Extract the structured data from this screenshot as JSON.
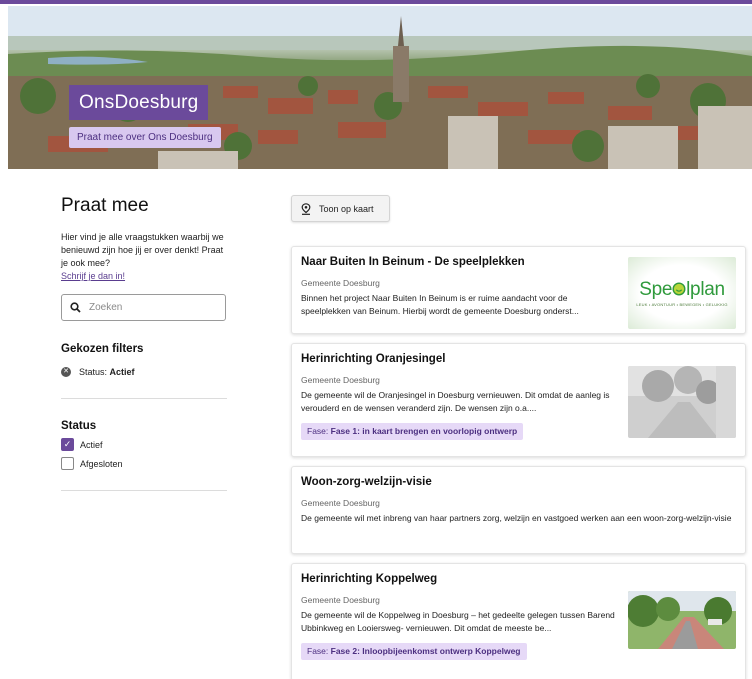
{
  "hero": {
    "brand": "OnsDoesburg",
    "tagline": "Praat mee over Ons Doesburg"
  },
  "sidebar": {
    "title": "Praat mee",
    "intro": "Hier vind je alle vraagstukken waarbij we benieuwd zijn hoe jij er over denkt! Praat je ook mee?",
    "signup_link": "Schrijf je dan in!",
    "search_placeholder": "Zoeken",
    "chosen_filters_title": "Gekozen filters",
    "chosen_filter_label": "Status:",
    "chosen_filter_value": "Actief",
    "status_title": "Status",
    "status_options": [
      {
        "label": "Actief",
        "checked": true
      },
      {
        "label": "Afgesloten",
        "checked": false
      }
    ]
  },
  "map_button": "Toon op kaart",
  "cards": [
    {
      "title": "Naar Buiten In Beinum - De speelplekken",
      "org": "Gemeente Doesburg",
      "description": "Binnen het project Naar Buiten In Beinum is er ruime aandacht voor de speelplekken van Beinum. Hierbij wordt de gemeente Doesburg onderst...",
      "logo_text": "Spe lplan",
      "logo_sub": "LEUK • AVONTUUR • BEWEGEN • GELUKKIG"
    },
    {
      "title": "Herinrichting Oranjesingel",
      "org": "Gemeente Doesburg",
      "description": "De gemeente wil de Oranjesingel in Doesburg vernieuwen. Dit omdat de aanleg is verouderd en de wensen veranderd zijn. De wensen zijn o.a....",
      "phase_label": "Fase:",
      "phase_value": "Fase 1: in kaart brengen en voorlopig ontwerp"
    },
    {
      "title": "Woon-zorg-welzijn-visie",
      "org": "Gemeente Doesburg",
      "description": "De gemeente wil met inbreng van haar partners zorg, welzijn en vastgoed werken aan een woon-zorg-welzijn-visie"
    },
    {
      "title": "Herinrichting Koppelweg",
      "org": "Gemeente Doesburg",
      "description": "De gemeente wil de Koppelweg in Doesburg – het gedeelte gelegen tussen Barend Ubbinkweg en Looiersweg- vernieuwen. Dit omdat de meeste be...",
      "phase_label": "Fase:",
      "phase_value": "Fase 2: Inloopbijeenkomst ontwerp Koppelweg"
    }
  ],
  "colors": {
    "brand": "#6b4a9b",
    "brand_light": "#d8c8ef",
    "phase_bg": "#e6d9f7",
    "logo_green": "#2f9a3c"
  }
}
